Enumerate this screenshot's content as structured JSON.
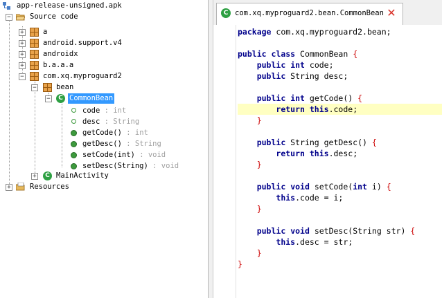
{
  "tree": {
    "root": "app-release-unsigned.apk",
    "source": "Source code",
    "packages": [
      "a",
      "android.support.v4",
      "androidx",
      "b.a.a.a",
      "com.xq.myproguard2"
    ],
    "bean_package": "bean",
    "selected_class": "CommonBean",
    "members": [
      {
        "name": "code",
        "type": ": int",
        "kind": "field"
      },
      {
        "name": "desc",
        "type": ": String",
        "kind": "field"
      },
      {
        "name": "getCode()",
        "type": ": int",
        "kind": "method"
      },
      {
        "name": "getDesc()",
        "type": ": String",
        "kind": "method"
      },
      {
        "name": "setCode(int)",
        "type": ": void",
        "kind": "method"
      },
      {
        "name": "setDesc(String)",
        "type": ": void",
        "kind": "method"
      }
    ],
    "main_activity": "MainActivity",
    "resources": "Resources"
  },
  "tab": {
    "title": "com.xq.myproguard2.bean.CommonBean",
    "close_icon": "close-icon",
    "class_icon": "class-icon"
  },
  "code": [
    {
      "parts": [
        [
          "kw",
          "package"
        ],
        [
          "id",
          " com.xq.myproguard2.bean;"
        ]
      ]
    },
    {
      "parts": []
    },
    {
      "parts": [
        [
          "kw",
          "public"
        ],
        [
          "id",
          " "
        ],
        [
          "kw",
          "class"
        ],
        [
          "id",
          " CommonBean "
        ],
        [
          "brc",
          "{"
        ]
      ]
    },
    {
      "parts": [
        [
          "id",
          "    "
        ],
        [
          "kw",
          "public"
        ],
        [
          "id",
          " "
        ],
        [
          "kw",
          "int"
        ],
        [
          "id",
          " code;"
        ]
      ]
    },
    {
      "parts": [
        [
          "id",
          "    "
        ],
        [
          "kw",
          "public"
        ],
        [
          "id",
          " String desc;"
        ]
      ]
    },
    {
      "parts": []
    },
    {
      "parts": [
        [
          "id",
          "    "
        ],
        [
          "kw",
          "public"
        ],
        [
          "id",
          " "
        ],
        [
          "kw",
          "int"
        ],
        [
          "id",
          " getCode() "
        ],
        [
          "brc",
          "{"
        ]
      ]
    },
    {
      "parts": [
        [
          "id",
          "        "
        ],
        [
          "kw",
          "return"
        ],
        [
          "id",
          " "
        ],
        [
          "kw",
          "this"
        ],
        [
          "id",
          ".code;"
        ]
      ],
      "highlight": true
    },
    {
      "parts": [
        [
          "id",
          "    "
        ],
        [
          "brc",
          "}"
        ]
      ]
    },
    {
      "parts": []
    },
    {
      "parts": [
        [
          "id",
          "    "
        ],
        [
          "kw",
          "public"
        ],
        [
          "id",
          " String getDesc() "
        ],
        [
          "brc",
          "{"
        ]
      ]
    },
    {
      "parts": [
        [
          "id",
          "        "
        ],
        [
          "kw",
          "return"
        ],
        [
          "id",
          " "
        ],
        [
          "kw",
          "this"
        ],
        [
          "id",
          ".desc;"
        ]
      ]
    },
    {
      "parts": [
        [
          "id",
          "    "
        ],
        [
          "brc",
          "}"
        ]
      ]
    },
    {
      "parts": []
    },
    {
      "parts": [
        [
          "id",
          "    "
        ],
        [
          "kw",
          "public"
        ],
        [
          "id",
          " "
        ],
        [
          "kw",
          "void"
        ],
        [
          "id",
          " setCode("
        ],
        [
          "kw",
          "int"
        ],
        [
          "id",
          " i) "
        ],
        [
          "brc",
          "{"
        ]
      ]
    },
    {
      "parts": [
        [
          "id",
          "        "
        ],
        [
          "kw",
          "this"
        ],
        [
          "id",
          ".code = i;"
        ]
      ]
    },
    {
      "parts": [
        [
          "id",
          "    "
        ],
        [
          "brc",
          "}"
        ]
      ]
    },
    {
      "parts": []
    },
    {
      "parts": [
        [
          "id",
          "    "
        ],
        [
          "kw",
          "public"
        ],
        [
          "id",
          " "
        ],
        [
          "kw",
          "void"
        ],
        [
          "id",
          " setDesc(String str) "
        ],
        [
          "brc",
          "{"
        ]
      ]
    },
    {
      "parts": [
        [
          "id",
          "        "
        ],
        [
          "kw",
          "this"
        ],
        [
          "id",
          ".desc = str;"
        ]
      ]
    },
    {
      "parts": [
        [
          "id",
          "    "
        ],
        [
          "brc",
          "}"
        ]
      ]
    },
    {
      "parts": [
        [
          "brc",
          "}"
        ]
      ]
    }
  ]
}
